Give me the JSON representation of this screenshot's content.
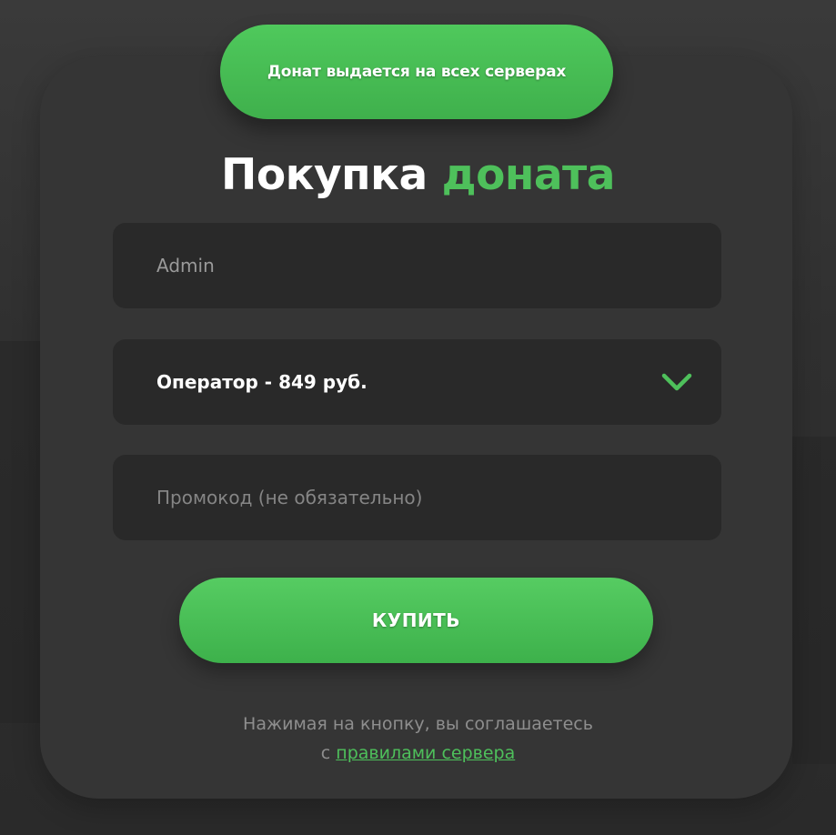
{
  "badge": {
    "text": "Донат выдается на всех серверах"
  },
  "title": {
    "main": "Покупка",
    "accent": "доната"
  },
  "form": {
    "username_value": "Admin",
    "privilege_selected": "Оператор - 849 руб.",
    "promo_placeholder": "Промокод (не обязательно)",
    "buy_label": "КУПИТЬ"
  },
  "agreement": {
    "line1": "Нажимая на кнопку, вы соглашаетесь",
    "prefix": "с",
    "link_text": "правилами сервера"
  },
  "colors": {
    "accent": "#4ec05b",
    "card_bg": "#353535",
    "field_bg": "#292929",
    "page_bg": "#2f2f2f"
  },
  "icons": {
    "select_toggle": "chevron-down-icon"
  }
}
